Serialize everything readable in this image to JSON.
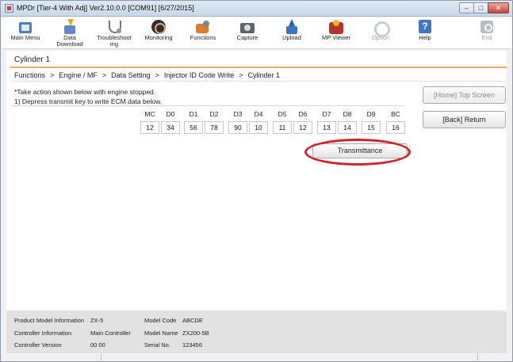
{
  "window": {
    "title": "MPDr [Tier-4 With Adj] Ver2.10.0.0 [COM91] [6/27/2015]",
    "min_label": "–",
    "max_label": "□",
    "close_label": "✕"
  },
  "toolbar": [
    {
      "label": "Main Menu",
      "icon": "home-monitor-icon",
      "enabled": true
    },
    {
      "label": "Data\nDownload",
      "icon": "download-icon",
      "enabled": true
    },
    {
      "label": "Troubleshoot\ning",
      "icon": "stethoscope-icon",
      "enabled": true
    },
    {
      "label": "Monitoring",
      "icon": "gauge-icon",
      "enabled": true
    },
    {
      "label": "Functions",
      "icon": "toolbox-icon",
      "enabled": true
    },
    {
      "label": "Capture",
      "icon": "camera-icon",
      "enabled": true
    },
    {
      "label": "Upload",
      "icon": "upload-icon",
      "enabled": true
    },
    {
      "label": "MP Viewer",
      "icon": "viewer-icon",
      "enabled": true
    },
    {
      "label": "Option",
      "icon": "gear-icon",
      "enabled": false
    },
    {
      "label": "Help",
      "icon": "help-icon",
      "enabled": true
    },
    {
      "label": "End",
      "icon": "power-icon",
      "enabled": false
    }
  ],
  "page": {
    "title": "Cylinder 1",
    "breadcrumb": [
      "Functions",
      "Engine / MF",
      "Data Setting",
      "Injector ID Code Write",
      "Cylinder 1"
    ],
    "breadcrumb_sep": ">",
    "note_line1": "*Take action shown below with engine stopped.",
    "note_line2": "1) Depress transmit key to write ECM data below."
  },
  "code_table": {
    "headers": [
      "MC",
      "D0",
      "D1",
      "D2",
      "D3",
      "D4",
      "D5",
      "D6",
      "D7",
      "D8",
      "D9",
      "BC"
    ],
    "values": [
      "12",
      "34",
      "56",
      "78",
      "90",
      "10",
      "11",
      "12",
      "13",
      "14",
      "15",
      "16"
    ]
  },
  "buttons": {
    "transmit": "Transmittance",
    "home": "[Home] Top Screen",
    "back": "[Back] Return"
  },
  "footer": {
    "product_model_label": "Product Model Information",
    "product_model_value": "ZX-5",
    "controller_info_label": "Controller Information",
    "controller_info_value": "Main Controller",
    "controller_version_label": "Controller Version",
    "controller_version_value": "00 00",
    "model_code_label": "Model Code",
    "model_code_value": "ABCDE",
    "model_name_label": "Model Name",
    "model_name_value": "ZX200-5B",
    "serial_label": "Serial No.",
    "serial_value": "123456"
  },
  "colors": {
    "accent_rule": "#f2a75c",
    "highlight_ring": "#d61f2b"
  }
}
